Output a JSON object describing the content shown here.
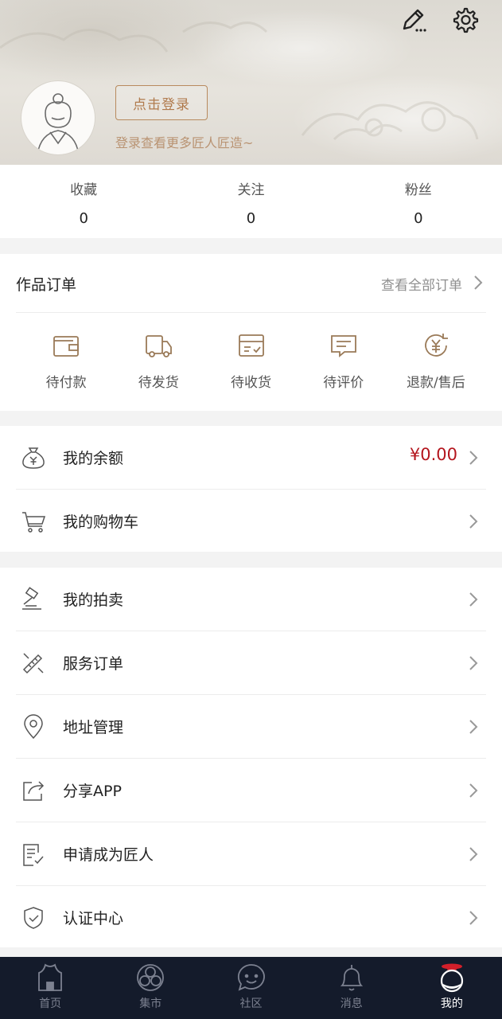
{
  "header": {
    "edit_icon": "edit-pencil-icon",
    "settings_icon": "gear-icon",
    "login_button": "点击登录",
    "login_tip": "登录查看更多匠人匠造~"
  },
  "stats": [
    {
      "label": "收藏",
      "value": "0"
    },
    {
      "label": "关注",
      "value": "0"
    },
    {
      "label": "粉丝",
      "value": "0"
    }
  ],
  "orders": {
    "title": "作品订单",
    "view_all": "查看全部订单",
    "items": [
      {
        "label": "待付款",
        "icon": "wallet-icon"
      },
      {
        "label": "待发货",
        "icon": "truck-icon"
      },
      {
        "label": "待收货",
        "icon": "box-icon"
      },
      {
        "label": "待评价",
        "icon": "comment-icon"
      },
      {
        "label": "退款/售后",
        "icon": "refund-icon"
      }
    ]
  },
  "wallet_section": [
    {
      "label": "我的余额",
      "value": "¥0.00",
      "icon": "money-bag-icon"
    },
    {
      "label": "我的购物车",
      "icon": "cart-icon"
    }
  ],
  "menu_section": [
    {
      "label": "我的拍卖",
      "icon": "gavel-icon"
    },
    {
      "label": "服务订单",
      "icon": "tools-icon"
    },
    {
      "label": "地址管理",
      "icon": "location-icon"
    },
    {
      "label": "分享APP",
      "icon": "share-icon"
    },
    {
      "label": "申请成为匠人",
      "icon": "application-icon"
    },
    {
      "label": "认证中心",
      "icon": "shield-check-icon"
    }
  ],
  "tabbar": [
    {
      "label": "首页",
      "icon": "home-icon"
    },
    {
      "label": "集市",
      "icon": "market-icon"
    },
    {
      "label": "社区",
      "icon": "community-icon"
    },
    {
      "label": "消息",
      "icon": "bell-icon"
    },
    {
      "label": "我的",
      "icon": "profile-icon",
      "active": true
    }
  ],
  "colors": {
    "accent_brown": "#b07a4c",
    "price_red": "#b4151d",
    "tabbar_bg": "#141b2b"
  }
}
